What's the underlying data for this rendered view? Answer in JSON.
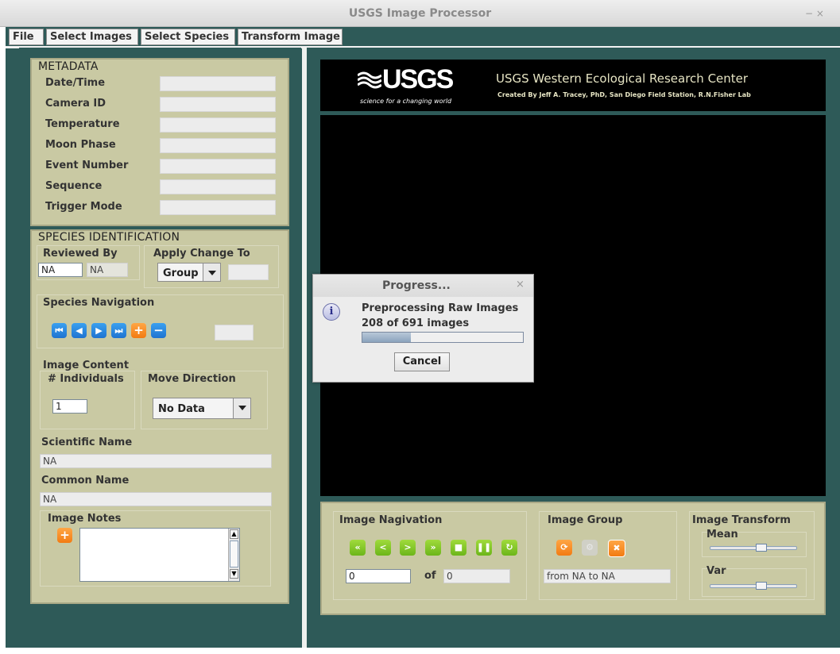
{
  "window": {
    "title": "USGS Image Processor",
    "controls": "−   ×"
  },
  "menu": {
    "items": [
      "File",
      "Select Images",
      "Select Species",
      "Transform Image"
    ]
  },
  "metadata": {
    "title": "METADATA",
    "fields": [
      "Date/Time",
      "Camera ID",
      "Temperature",
      "Moon Phase",
      "Event Number",
      "Sequence",
      "Trigger Mode"
    ]
  },
  "species": {
    "title": "SPECIES IDENTIFICATION",
    "reviewed_by_label": "Reviewed By",
    "reviewed_by_values": [
      "NA",
      "NA"
    ],
    "apply_change_label": "Apply Change To",
    "apply_change_value": "Group",
    "navigation_label": "Species Navigation",
    "image_content_label": "Image Content",
    "individuals_label": "# Individuals",
    "individuals_value": "1",
    "move_direction_label": "Move Direction",
    "move_direction_value": "No Data",
    "scientific_name_label": "Scientific Name",
    "scientific_name_value": "NA",
    "common_name_label": "Common Name",
    "common_name_value": "NA",
    "notes_label": "Image Notes"
  },
  "header": {
    "logo_text": "USGS",
    "logo_tagline": "science for a changing world",
    "org": "USGS Western Ecological Research Center",
    "credit": "Created By Jeff A. Tracey, PhD, San Diego Field Station, R.N.Fisher Lab"
  },
  "image_nav": {
    "label": "Image Nagivation",
    "current": "0",
    "of_label": "of",
    "total": "0"
  },
  "image_group": {
    "label": "Image Group",
    "range": "from NA to NA"
  },
  "image_transform": {
    "label": "Image Transform",
    "mean_label": "Mean",
    "mean_level": 0.6,
    "var_label": "Var",
    "var_level": 0.6
  },
  "progress": {
    "title": "Progress...",
    "close": "×",
    "message": "Preprocessing Raw Images",
    "status": "208 of 691 images",
    "fraction": 0.301,
    "cancel": "Cancel"
  },
  "colors": {
    "app_bg": "#2e5a58",
    "panel": "#c9c9a3",
    "accent_blue": "#1f73d0",
    "accent_orange": "#f27b12",
    "accent_green": "#6cb51a"
  }
}
